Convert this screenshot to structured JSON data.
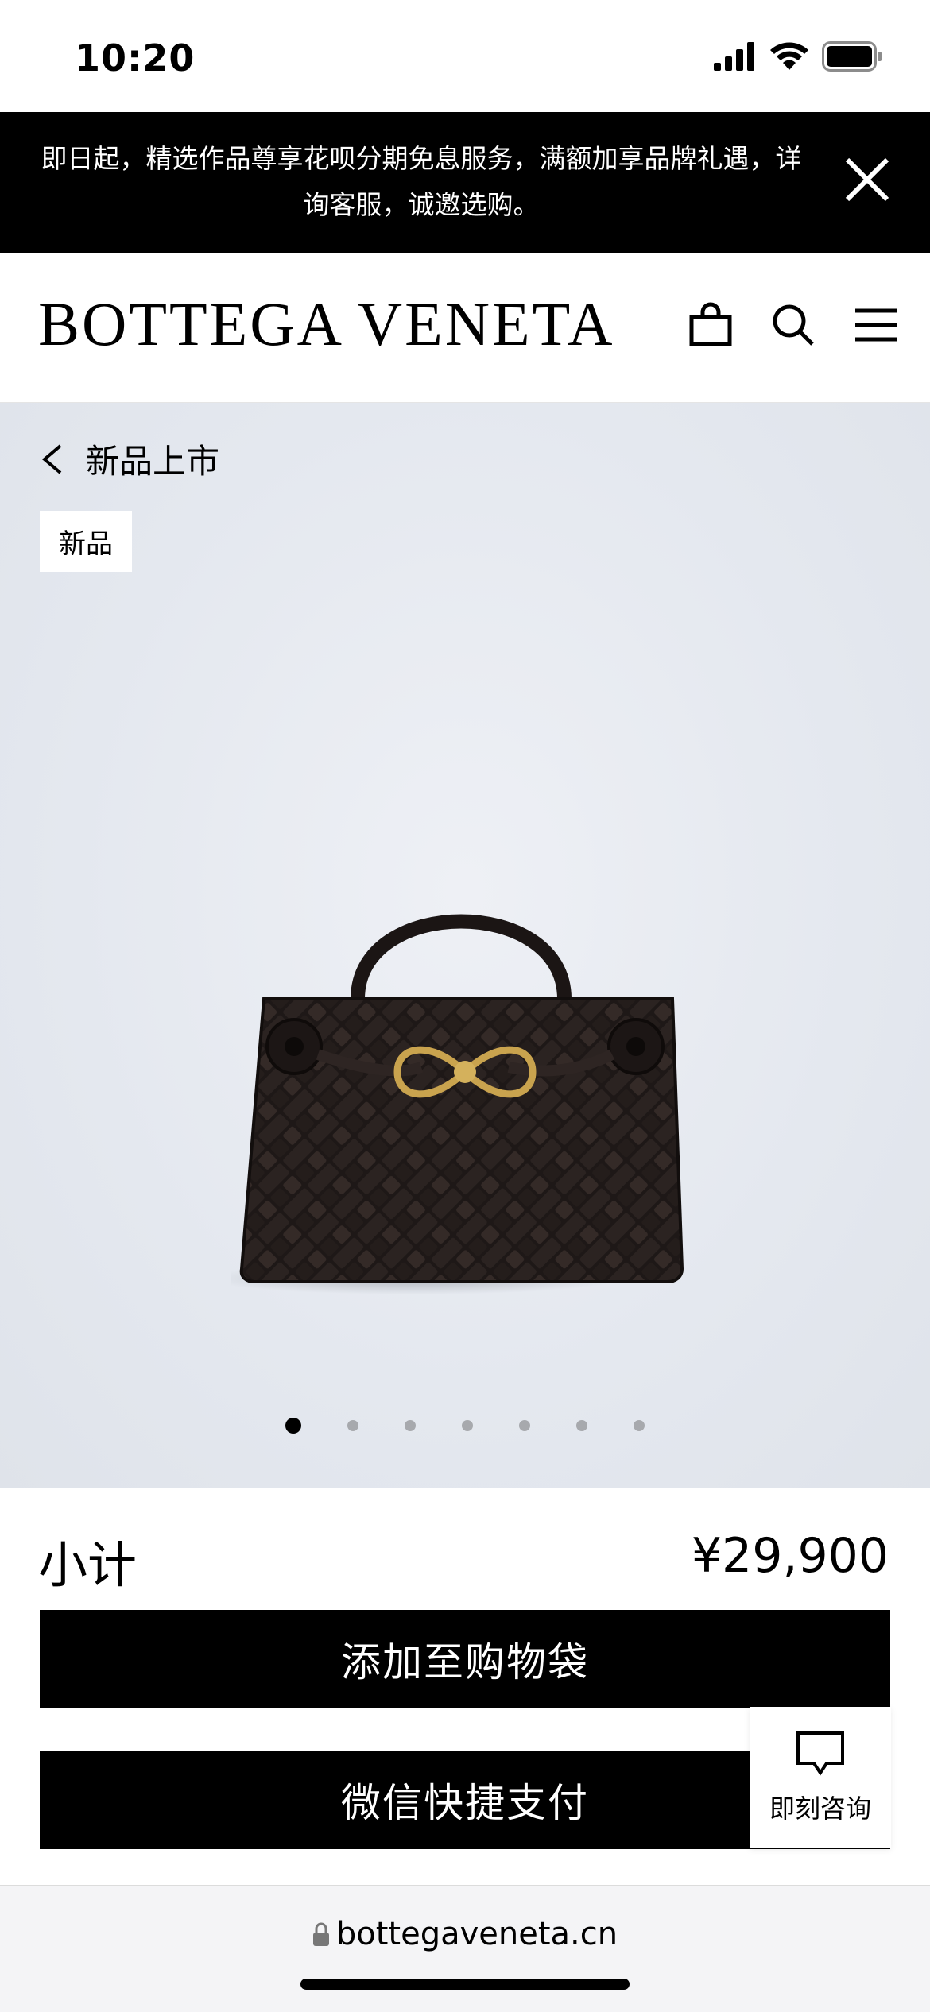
{
  "status_bar": {
    "time": "10:20"
  },
  "promo": {
    "text": "即日起，精选作品尊享花呗分期免息服务，满额加享品牌礼遇，详询客服，诚邀选购。"
  },
  "header": {
    "brand": "BOTTEGA VENETA"
  },
  "hero": {
    "back_label": "新品上市",
    "badge": "新品",
    "carousel": {
      "total": 7,
      "active_index": 0
    }
  },
  "checkout": {
    "subtotal_label": "小计",
    "price": "¥29,900",
    "add_to_bag": "添加至购物袋",
    "wechat_pay": "微信快捷支付"
  },
  "consult": {
    "label": "即刻咨询"
  },
  "browser": {
    "url": "bottegaveneta.cn"
  },
  "icons": {
    "signal": "signal-icon",
    "wifi": "wifi-icon",
    "battery": "battery-icon",
    "close": "close-icon",
    "bag": "shopping-bag-icon",
    "search": "search-icon",
    "menu": "menu-icon",
    "back": "chevron-left-icon",
    "chat": "chat-icon",
    "lock": "lock-icon"
  },
  "colors": {
    "accent": "#000000",
    "hero_bg": "#e4e8ef",
    "dot_inactive": "#a7a9ad"
  }
}
